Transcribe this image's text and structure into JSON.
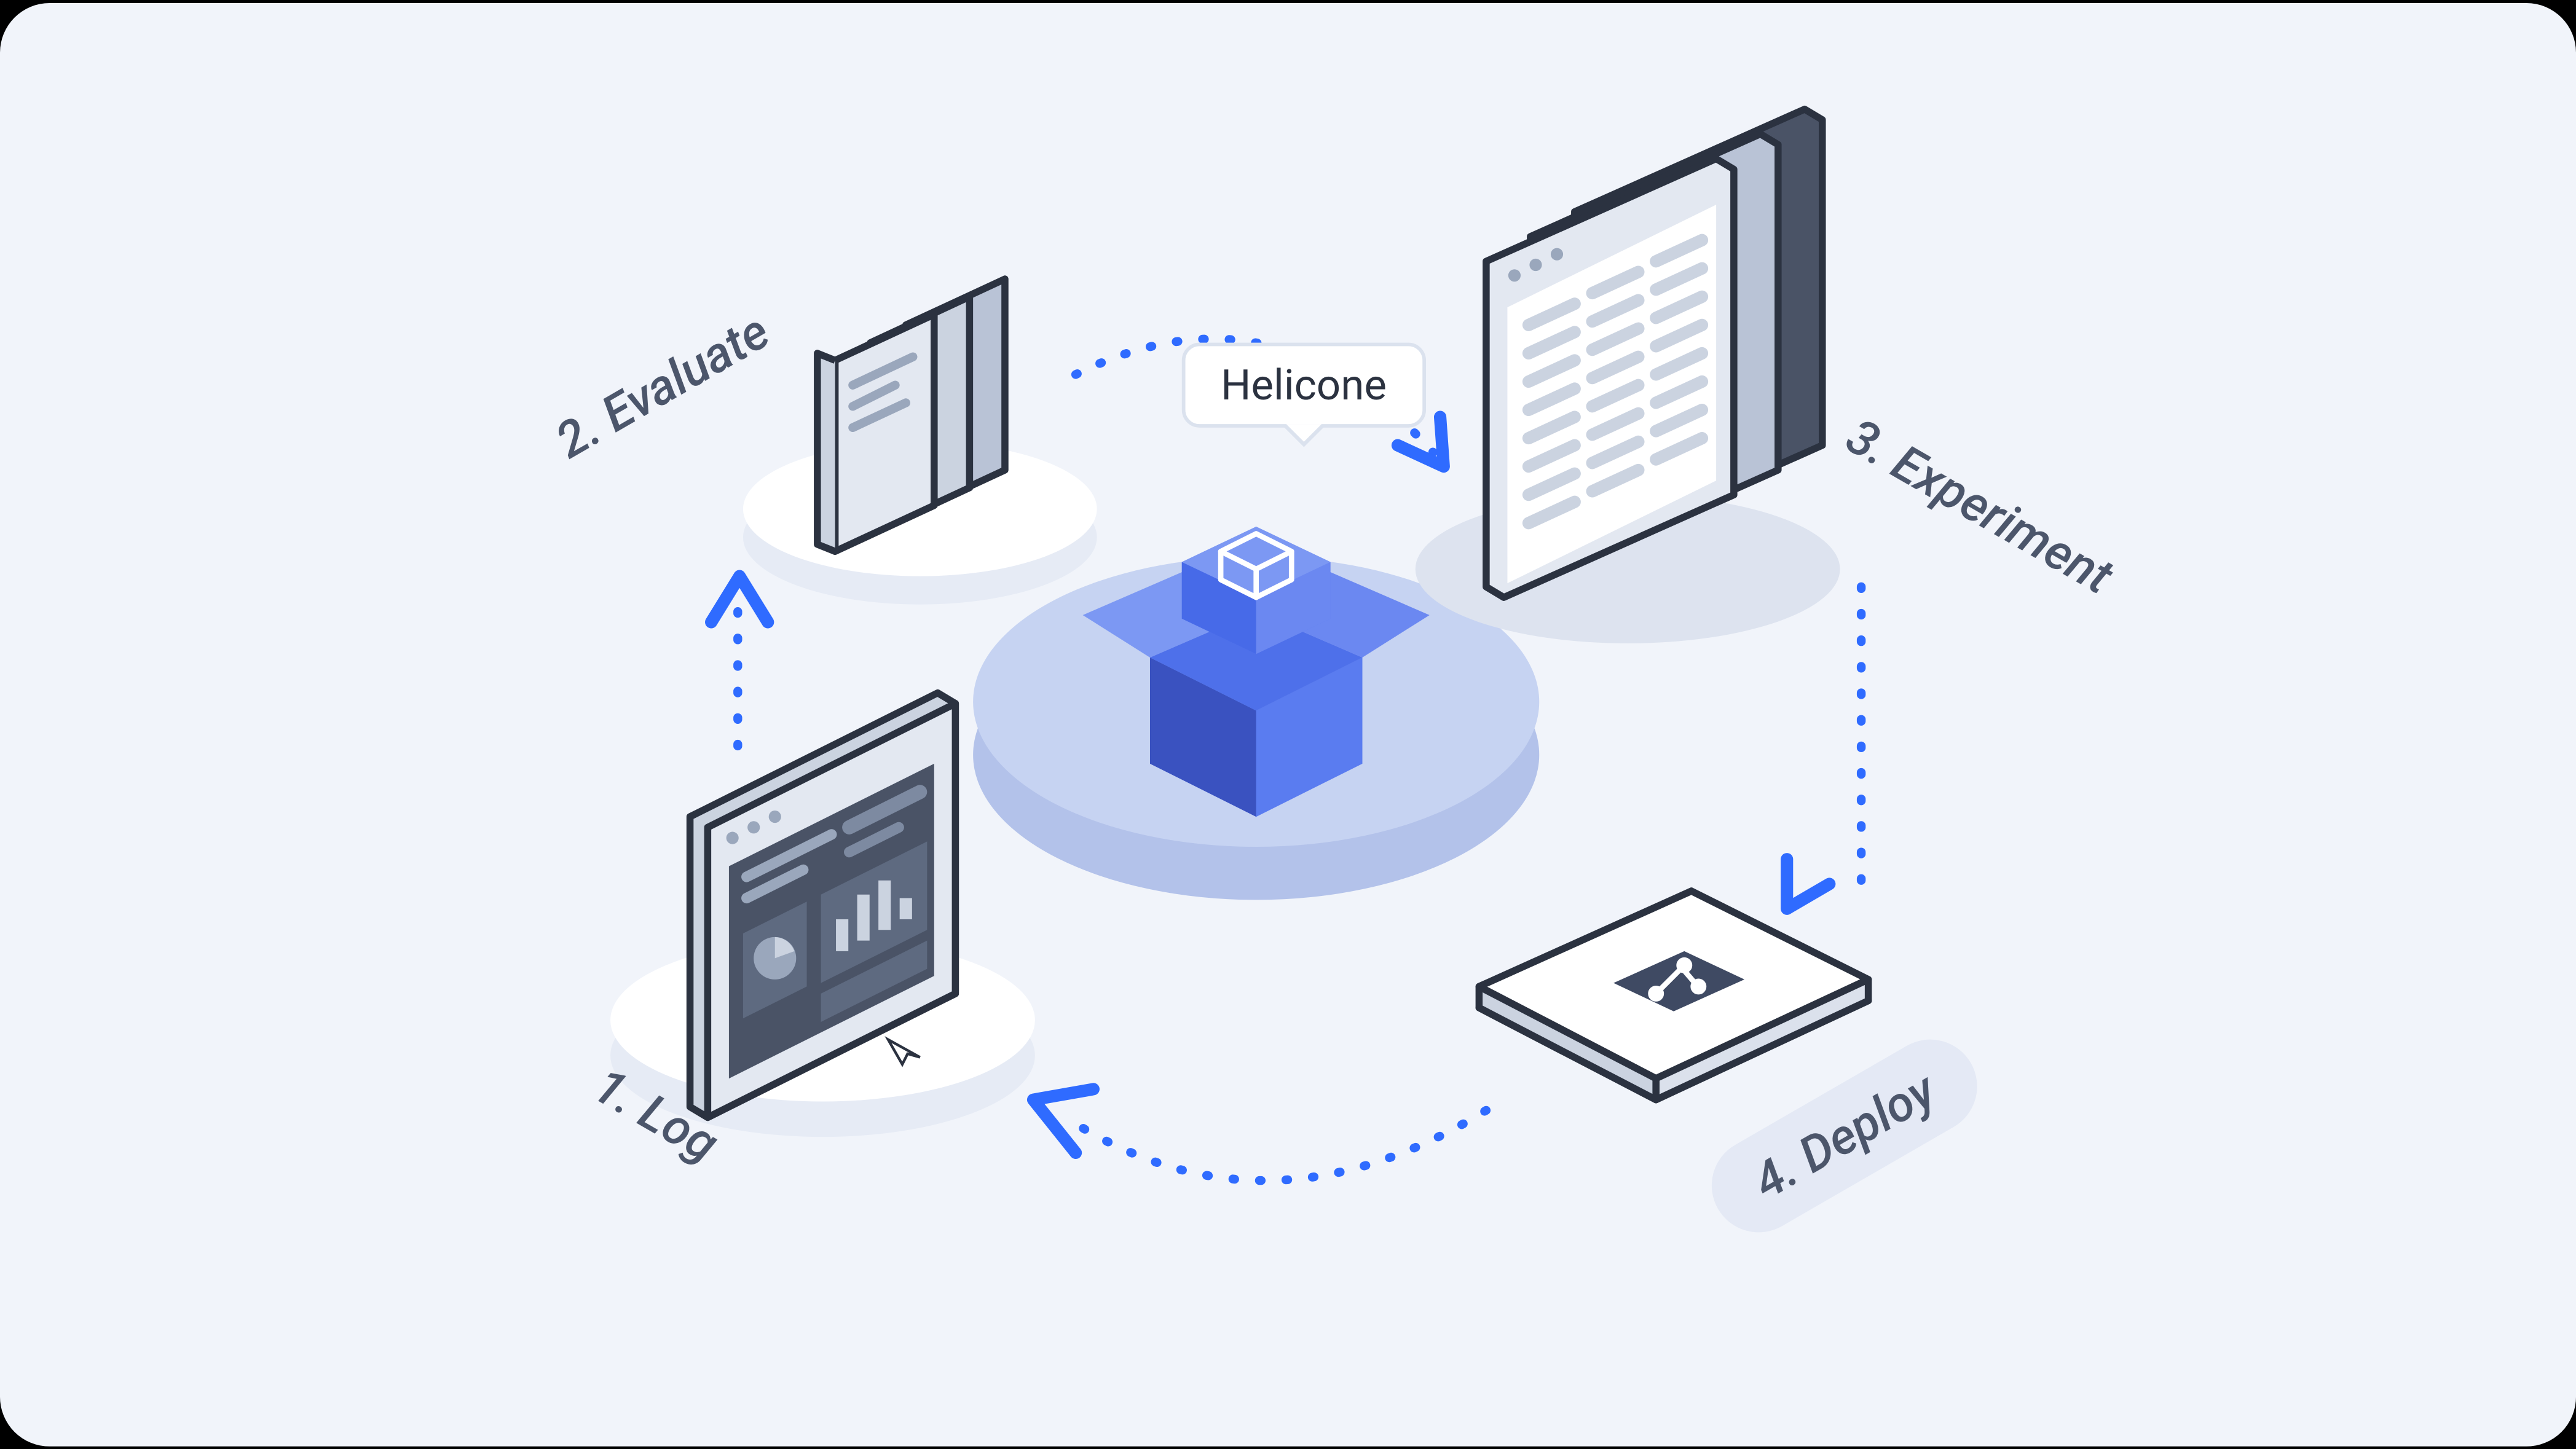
{
  "diagram": {
    "center_label": "Helicone",
    "steps": {
      "log": {
        "label": "1. Log",
        "icon": "dashboard-monitor-icon"
      },
      "evaluate": {
        "label": "2. Evaluate",
        "icon": "document-stack-icon"
      },
      "experiment": {
        "label": "3. Experiment",
        "icon": "spreadsheet-windows-icon"
      },
      "deploy": {
        "label": "4. Deploy",
        "icon": "deploy-card-icon"
      }
    },
    "flow_order": [
      "log",
      "evaluate",
      "experiment",
      "deploy",
      "log"
    ],
    "colors": {
      "background": "#f1f4fa",
      "arrow": "#2f6bff",
      "dotted_path": "#2f6bff",
      "box_primary": "#5a7cf0",
      "box_primary_dark": "#3a52c0",
      "platform": "#c6d3f2",
      "platform_shadow": "#b3c2ea",
      "text": "#4c566b",
      "panel_outline": "#2b3240",
      "panel_gray": "#cbd3e0",
      "panel_darkgray": "#4a5366"
    }
  }
}
